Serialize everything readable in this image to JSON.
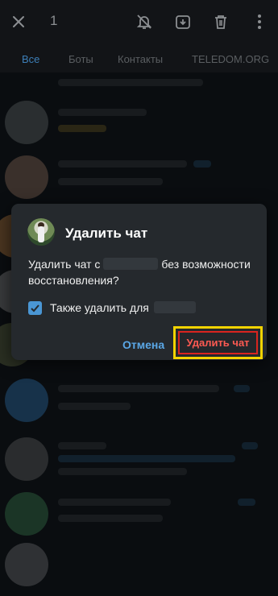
{
  "topbar": {
    "close_icon": "close-icon",
    "selected_count": "1",
    "mute_icon": "mute-bell-icon",
    "archive_icon": "archive-icon",
    "delete_icon": "trash-icon",
    "more_icon": "more-vertical-icon"
  },
  "tabs": [
    {
      "label": "Все",
      "active": true
    },
    {
      "label": "Боты",
      "active": false
    },
    {
      "label": "Контакты",
      "active": false
    },
    {
      "label": "TELEDOM.ORG",
      "active": false
    }
  ],
  "dialog": {
    "title": "Удалить чат",
    "message_prefix": "Удалить чат с",
    "message_suffix": "без возможности восстановления?",
    "checkbox_label": "Также удалить для",
    "checkbox_checked": true,
    "cancel_label": "Отмена",
    "confirm_label": "Удалить чат",
    "highlight_color": "#f2d300",
    "danger_color": "#ff5a52",
    "accent_color": "#5aa7e6"
  }
}
